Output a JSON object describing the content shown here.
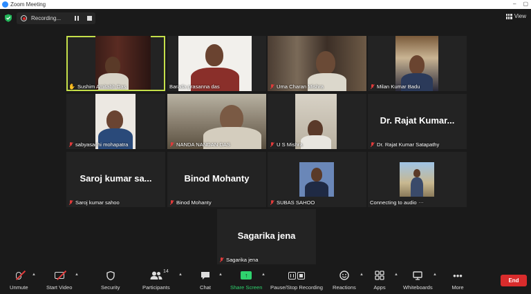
{
  "window": {
    "title": "Zoom Meeting",
    "controls": [
      "–",
      "▢"
    ]
  },
  "topbar": {
    "recording_label": "Recording...",
    "view_label": "View"
  },
  "participants": [
    {
      "name": "Sushim Amitabh Das",
      "type": "video",
      "active": true,
      "hand": true,
      "muted": false
    },
    {
      "name": "Barada prasanna das",
      "type": "video",
      "active": false,
      "hand": false,
      "muted": false
    },
    {
      "name": "Uma Charan Mishra",
      "type": "video",
      "active": false,
      "hand": false,
      "muted": true
    },
    {
      "name": "Milan  Kumar Badu",
      "type": "video",
      "active": false,
      "hand": false,
      "muted": true
    },
    {
      "name": "sabyasachi mohapatra",
      "type": "video",
      "active": false,
      "hand": false,
      "muted": true
    },
    {
      "name": "NANDA NANDAN DAS",
      "type": "video",
      "active": false,
      "hand": false,
      "muted": true
    },
    {
      "name": "U S Mishra",
      "type": "video",
      "active": false,
      "hand": false,
      "muted": true
    },
    {
      "name": "Dr. Rajat Kumar Satapathy",
      "display": "Dr. Rajat Kumar...",
      "type": "name",
      "active": false,
      "hand": false,
      "muted": true
    },
    {
      "name": "Saroj kumar sahoo",
      "display": "Saroj  kumar  sa...",
      "type": "name",
      "active": false,
      "hand": false,
      "muted": true
    },
    {
      "name": "Binod Mohanty",
      "display": "Binod Mohanty",
      "type": "name",
      "active": false,
      "hand": false,
      "muted": true
    },
    {
      "name": "SUBAS SAHOO",
      "type": "photo",
      "active": false,
      "hand": false,
      "muted": true
    },
    {
      "name": "Connecting to audio",
      "type": "photo",
      "active": false,
      "hand": false,
      "muted": false
    },
    {
      "name": "Sagarika jena",
      "display": "Sagarika jena",
      "type": "name",
      "active": false,
      "hand": false,
      "muted": true
    }
  ],
  "toolbar": {
    "unmute": "Unmute",
    "start_video": "Start Video",
    "security": "Security",
    "participants": "Participants",
    "participants_count": "14",
    "chat": "Chat",
    "share_screen": "Share Screen",
    "record": "Pause/Stop Recording",
    "reactions": "Reactions",
    "apps": "Apps",
    "whiteboards": "Whiteboards",
    "more": "More",
    "end": "End"
  },
  "colors": {
    "active_speaker": "#c5e04a",
    "share": "#2fd36e",
    "end": "#d92c2c",
    "muted": "#e03b3b"
  }
}
